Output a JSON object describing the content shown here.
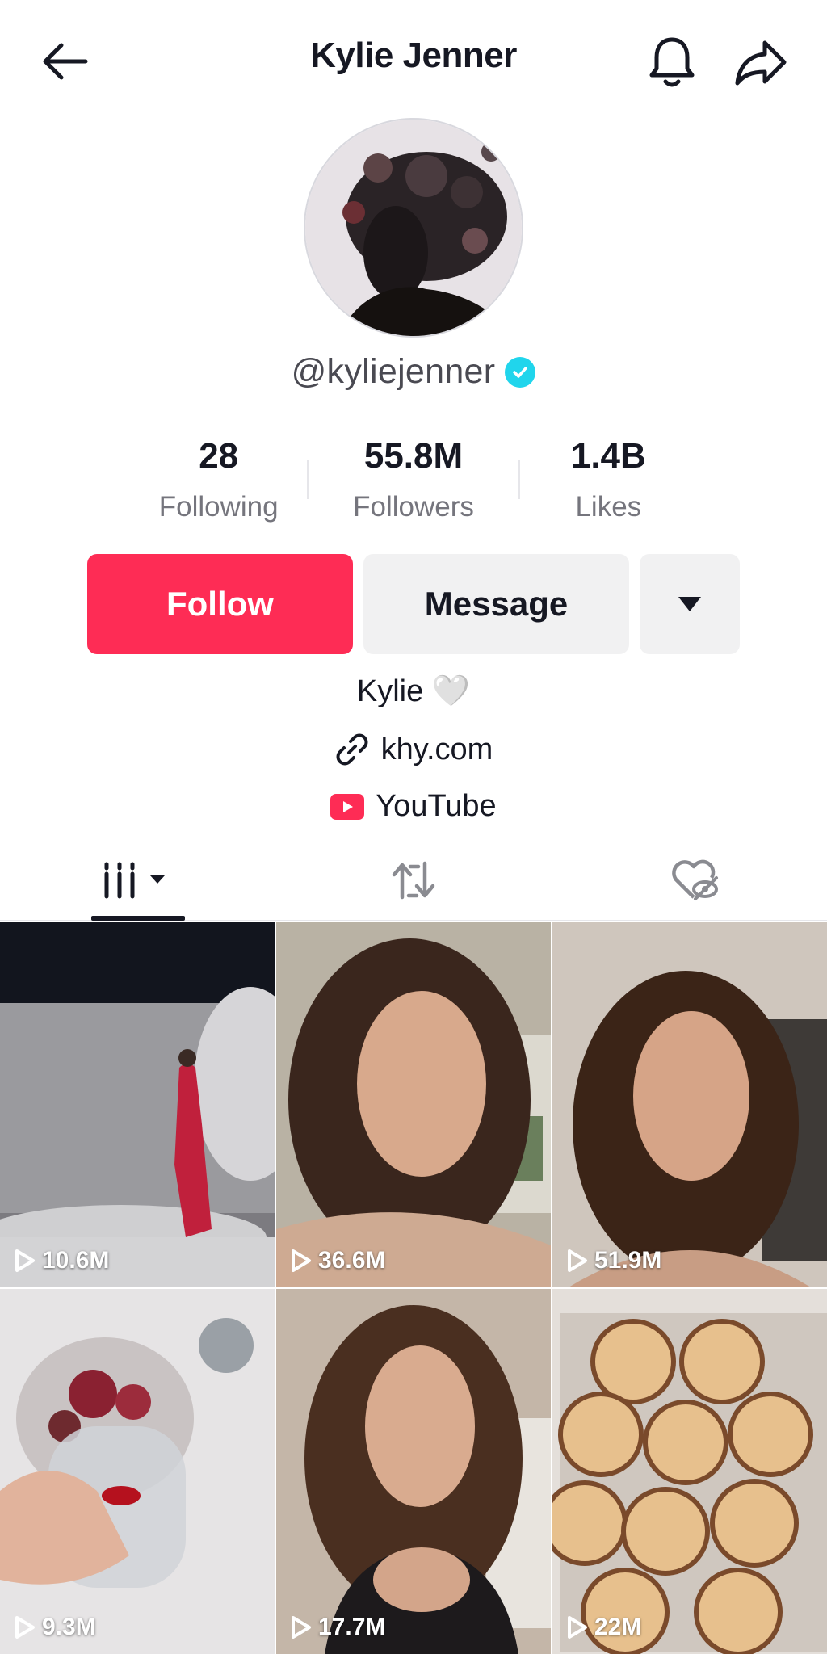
{
  "header": {
    "title": "Kylie Jenner"
  },
  "profile": {
    "username": "@kyliejenner",
    "verified": true,
    "stats": [
      {
        "value": "28",
        "label": "Following"
      },
      {
        "value": "55.8M",
        "label": "Followers"
      },
      {
        "value": "1.4B",
        "label": "Likes"
      }
    ],
    "follow_label": "Follow",
    "message_label": "Message",
    "bio": "Kylie 🤍",
    "link": "khy.com",
    "youtube_label": "YouTube"
  },
  "tabs": [
    {
      "icon": "videos-grid-icon",
      "active": true
    },
    {
      "icon": "repost-icon",
      "active": false
    },
    {
      "icon": "liked-hidden-icon",
      "active": false
    }
  ],
  "videos": [
    {
      "views": "10.6M"
    },
    {
      "views": "36.6M"
    },
    {
      "views": "51.9M"
    },
    {
      "views": "9.3M"
    },
    {
      "views": "17.7M"
    },
    {
      "views": "22M"
    }
  ],
  "colors": {
    "accent": "#fe2c55",
    "verified": "#20d5ec",
    "youtube": "#fe2c55"
  }
}
